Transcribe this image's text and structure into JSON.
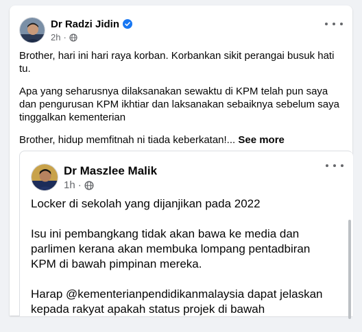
{
  "post": {
    "author": "Dr Radzi Jidin",
    "time": "2h",
    "paragraphs": [
      "Brother, hari ini hari raya korban. Korbankan sikit perangai busuk hati tu.",
      "Apa yang seharusnya dilaksanakan sewaktu di KPM telah pun saya dan pengurusan KPM ikhtiar dan laksanakan sebaiknya sebelum saya tinggalkan kementerian"
    ],
    "last_line": "Brother, hidup memfitnah ni tiada keberkatan!...",
    "see_more": "See more"
  },
  "shared": {
    "author": "Dr Maszlee Malik",
    "time": "1h",
    "paragraphs": [
      "Locker di sekolah yang dijanjikan pada 2022",
      "Isu ini pembangkang tidak akan bawa ke media dan parlimen kerana akan membuka lompang pentadbiran KPM di bawah pimpinan mereka.",
      "Harap @kementerianpendidikanmalaysia dapat jelaskan kepada rakyat apakah status projek di bawah"
    ]
  },
  "colors": {
    "verified": "#1877f2",
    "secondary_text": "#65676b",
    "background": "#f0f2f5"
  },
  "icons": [
    "verified-badge-icon",
    "globe-icon",
    "more-options-icon"
  ]
}
